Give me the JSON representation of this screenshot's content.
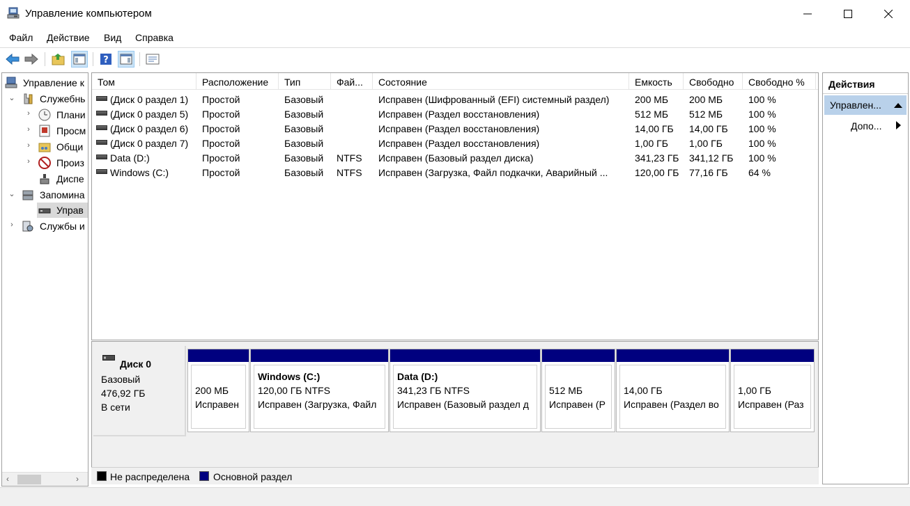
{
  "window": {
    "title": "Управление компьютером"
  },
  "menu": [
    "Файл",
    "Действие",
    "Вид",
    "Справка"
  ],
  "tree": {
    "items": [
      {
        "label": "Управление к"
      },
      {
        "label": "Служебнь"
      },
      {
        "label": "Плани"
      },
      {
        "label": "Просм"
      },
      {
        "label": "Общи"
      },
      {
        "label": "Произ"
      },
      {
        "label": "Диспе"
      },
      {
        "label": "Запомина"
      },
      {
        "label": "Управ"
      },
      {
        "label": "Службы и"
      }
    ]
  },
  "volume_list": {
    "columns": [
      "Том",
      "Расположение",
      "Тип",
      "Фай...",
      "Состояние",
      "Емкость",
      "Свободно",
      "Свободно %"
    ],
    "rows": [
      [
        "(Диск 0 раздел 1)",
        "Простой",
        "Базовый",
        "",
        "Исправен (Шифрованный (EFI) системный раздел)",
        "200 МБ",
        "200 МБ",
        "100 %"
      ],
      [
        "(Диск 0 раздел 5)",
        "Простой",
        "Базовый",
        "",
        "Исправен (Раздел восстановления)",
        "512 МБ",
        "512 МБ",
        "100 %"
      ],
      [
        "(Диск 0 раздел 6)",
        "Простой",
        "Базовый",
        "",
        "Исправен (Раздел восстановления)",
        "14,00 ГБ",
        "14,00 ГБ",
        "100 %"
      ],
      [
        "(Диск 0 раздел 7)",
        "Простой",
        "Базовый",
        "",
        "Исправен (Раздел восстановления)",
        "1,00 ГБ",
        "1,00 ГБ",
        "100 %"
      ],
      [
        "Data (D:)",
        "Простой",
        "Базовый",
        "NTFS",
        "Исправен (Базовый раздел диска)",
        "341,23 ГБ",
        "341,12 ГБ",
        "100 %"
      ],
      [
        "Windows (C:)",
        "Простой",
        "Базовый",
        "NTFS",
        "Исправен (Загрузка, Файл подкачки, Аварийный ...",
        "120,00 ГБ",
        "77,16 ГБ",
        "64 %"
      ]
    ]
  },
  "disk": {
    "name": "Диск 0",
    "type": "Базовый",
    "size": "476,92 ГБ",
    "status": "В сети",
    "partitions": [
      {
        "title": "",
        "size": "200 МБ",
        "status": "Исправен"
      },
      {
        "title": "Windows  (C:)",
        "size": "120,00 ГБ NTFS",
        "status": "Исправен (Загрузка, Файл"
      },
      {
        "title": "Data  (D:)",
        "size": "341,23 ГБ NTFS",
        "status": "Исправен (Базовый раздел д"
      },
      {
        "title": "",
        "size": "512 МБ",
        "status": "Исправен (Р"
      },
      {
        "title": "",
        "size": "14,00 ГБ",
        "status": "Исправен (Раздел во"
      },
      {
        "title": "",
        "size": "1,00 ГБ",
        "status": "Исправен (Раз"
      }
    ],
    "partition_bar_color": "#00007f"
  },
  "legend": [
    {
      "label": "Не распределена",
      "color": "#000000"
    },
    {
      "label": "Основной раздел",
      "color": "#00007f"
    }
  ],
  "actions": {
    "title": "Действия",
    "selected": "Управлен...",
    "more": "Допо..."
  }
}
